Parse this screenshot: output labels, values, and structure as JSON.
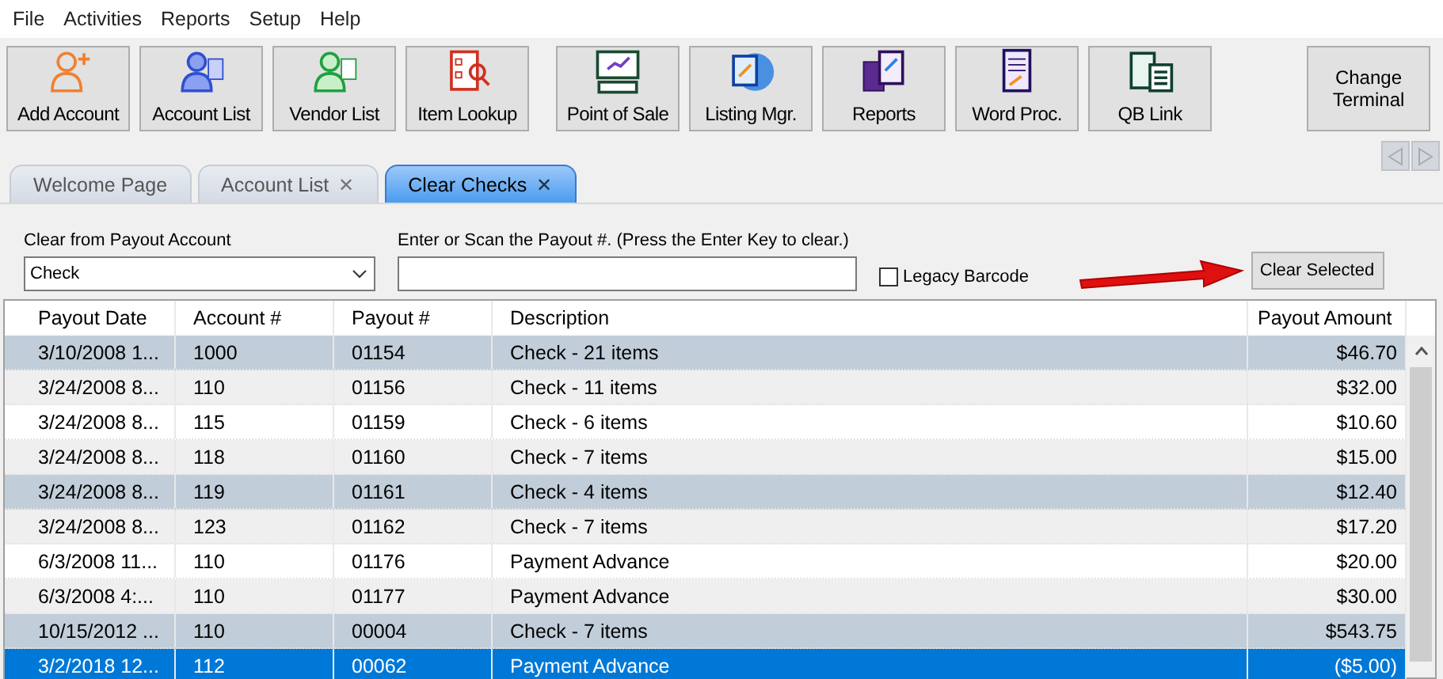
{
  "menu": [
    "File",
    "Activities",
    "Reports",
    "Setup",
    "Help"
  ],
  "toolbar": [
    {
      "label": "Add Account"
    },
    {
      "label": "Account List"
    },
    {
      "label": "Vendor List"
    },
    {
      "label": "Item Lookup"
    },
    {
      "label": "Point of Sale"
    },
    {
      "label": "Listing Mgr."
    },
    {
      "label": "Reports"
    },
    {
      "label": "Word Proc."
    },
    {
      "label": "QB Link"
    }
  ],
  "change_terminal": "Change Terminal",
  "tabs": [
    {
      "label": "Welcome Page",
      "selected": false
    },
    {
      "label": "Account List",
      "selected": false,
      "close": "✕"
    },
    {
      "label": "Clear Checks",
      "selected": true,
      "close": "✕"
    }
  ],
  "form": {
    "account_label": "Clear from Payout Account",
    "account_value": "Check",
    "payout_label": "Enter or Scan the Payout #.  (Press the Enter Key to clear.)",
    "legacy_barcode": {
      "label": "Legacy Barcode",
      "checked": false
    },
    "clear_button": "Clear Selected"
  },
  "table": {
    "columns": [
      "Payout Date",
      "Account #",
      "Payout #",
      "Description",
      "Payout Amount"
    ],
    "rows": [
      {
        "cells": [
          "3/10/2008 1...",
          "1000",
          "01154",
          "Check - 21 items",
          "$46.70"
        ],
        "marked": true,
        "selected": false
      },
      {
        "cells": [
          "3/24/2008 8...",
          "110",
          "01156",
          "Check - 11 items",
          "$32.00"
        ],
        "marked": false,
        "selected": false
      },
      {
        "cells": [
          "3/24/2008 8...",
          "115",
          "01159",
          "Check - 6 items",
          "$10.60"
        ],
        "marked": false,
        "selected": false
      },
      {
        "cells": [
          "3/24/2008 8...",
          "118",
          "01160",
          "Check - 7 items",
          "$15.00"
        ],
        "marked": false,
        "selected": false
      },
      {
        "cells": [
          "3/24/2008 8...",
          "119",
          "01161",
          "Check - 4 items",
          "$12.40"
        ],
        "marked": true,
        "selected": false
      },
      {
        "cells": [
          "3/24/2008 8...",
          "123",
          "01162",
          "Check - 7 items",
          "$17.20"
        ],
        "marked": false,
        "selected": false
      },
      {
        "cells": [
          "6/3/2008 11...",
          "110",
          "01176",
          "Payment Advance",
          "$20.00"
        ],
        "marked": false,
        "selected": false
      },
      {
        "cells": [
          "6/3/2008 4:...",
          "110",
          "01177",
          "Payment Advance",
          "$30.00"
        ],
        "marked": false,
        "selected": false
      },
      {
        "cells": [
          "10/15/2012 ...",
          "110",
          "00004",
          "Check - 7 items",
          "$543.75"
        ],
        "marked": true,
        "selected": false
      },
      {
        "cells": [
          "3/2/2018 12...",
          "112",
          "00062",
          "Payment Advance",
          "($5.00)"
        ],
        "marked": false,
        "selected": true
      }
    ]
  }
}
